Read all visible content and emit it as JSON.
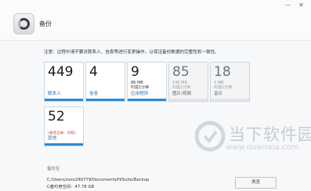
{
  "window": {
    "title": "备份",
    "buttons": {
      "minimize": "—",
      "close": "✕"
    }
  },
  "notice": "注意：过程中请不要对联系人、信息等进行变更操作，以保证备份数据的完整性和一致性。",
  "tiles": [
    {
      "count": "449",
      "size": "",
      "time": "",
      "label": "联系人",
      "active": true
    },
    {
      "count": "4",
      "size": "",
      "time": "",
      "label": "信息",
      "active": true
    },
    {
      "count": "9",
      "size": "86 MB",
      "time": "约需1分钟",
      "label": "应用程序",
      "active": true
    },
    {
      "count": "85",
      "size": "140 MB",
      "time": "约需1分钟",
      "label": "图片/视频",
      "active": false
    },
    {
      "count": "18",
      "size": "3 MB",
      "time": "约需1分钟",
      "label": "音乐",
      "active": false
    },
    {
      "count": "52",
      "sub": "(通话记录、日程)",
      "label": "其他",
      "active": true
    }
  ],
  "backup": {
    "label": "备份至",
    "path": "C:/Users/zxxx240779/Documents/HiSuite/Backup",
    "free": "C盘可用空间：47.78 GB",
    "browse_label": "浏览"
  },
  "watermark": {
    "text": "当下软件园",
    "url": "www.downxia.com"
  },
  "colors": {
    "accent": "#2f8ad6",
    "link": "#2c6fb3"
  }
}
